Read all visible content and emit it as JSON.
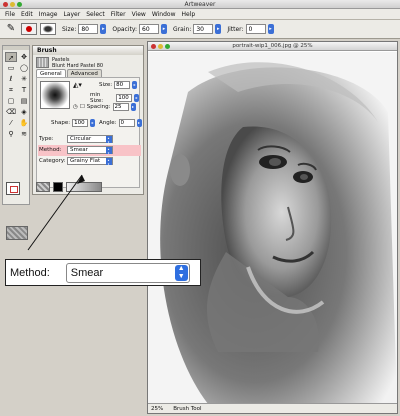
{
  "app": {
    "title": "Artweaver"
  },
  "menu": [
    "File",
    "Edit",
    "Image",
    "Layer",
    "Select",
    "Filter",
    "View",
    "Window",
    "Help"
  ],
  "tool_options": {
    "size_label": "Size:",
    "size_value": "80",
    "opacity_label": "Opacity:",
    "opacity_value": "60",
    "grain_label": "Grain:",
    "grain_value": "30",
    "jitter_label": "Jitter:",
    "jitter_value": "0"
  },
  "brush_panel": {
    "title": "Brush",
    "preset_category": "Pastels",
    "preset_name": "Blunt Hard Pastel 80",
    "tabs": [
      "General",
      "Advanced"
    ],
    "size_label": "Size:",
    "size_value": "80",
    "min_size_label": "min Size:",
    "min_size_value": "100",
    "spacing_label": "Spacing:",
    "spacing_value": "25",
    "shape_label": "Shape:",
    "shape_value": "100",
    "angle_label": "Angle:",
    "angle_value": "0",
    "type_label": "Type:",
    "type_value": "Circular",
    "method_label": "Method:",
    "method_value": "Smear",
    "category_label": "Category:",
    "category_value": "Grainy Flat"
  },
  "document": {
    "title": "portrait-wip1_006.jpg @ 25%",
    "zoom": "25%",
    "status_tool": "Brush Tool"
  },
  "callout": {
    "label": "Method:",
    "value": "Smear"
  },
  "colors": {
    "method_highlight": "#f8c3c7",
    "select_arrow": "#2f6fe0"
  }
}
